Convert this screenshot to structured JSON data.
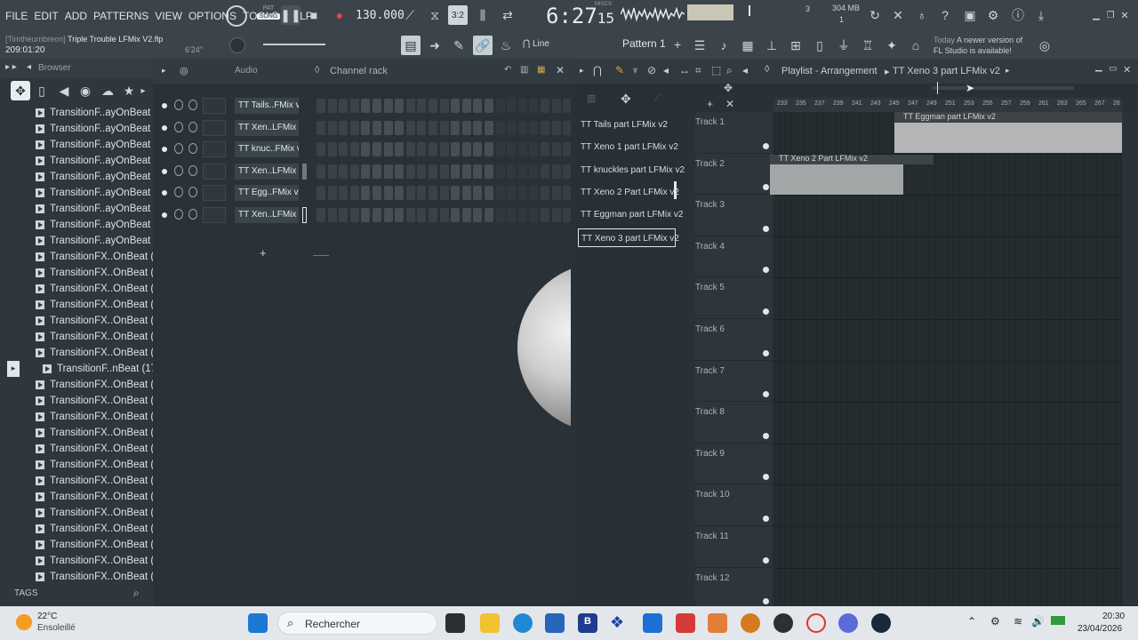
{
  "menu": [
    "FILE",
    "EDIT",
    "ADD",
    "PATTERNS",
    "VIEW",
    "OPTIONS",
    "TOOLS",
    "HELP"
  ],
  "transport": {
    "pat_label": "PAT",
    "song_label": "SONG",
    "tempo": "130.000",
    "time": "6:27",
    "time_small": "15",
    "cpu": "304 MB",
    "cpu_sub": "1",
    "misc": "MISCS",
    "beat": "3",
    "beat_sub": "3:2"
  },
  "hint": {
    "title": "Today",
    "line1": "A newer version of",
    "line2": "FL Studio is available!"
  },
  "project": {
    "user": "[Timtheumbreon]",
    "file": "Triple Trouble LFMix V2.flp",
    "time": "209:01:20",
    "pos": "6'24\""
  },
  "toolbar": {
    "snap": "Line",
    "pattern": "Pattern 1"
  },
  "browser": {
    "title": "Browser",
    "items": [
      "TransitionF..ayOnBeat (1)",
      "TransitionF..ayOnBeat (2)",
      "TransitionF..ayOnBeat (3)",
      "TransitionF..ayOnBeat (4)",
      "TransitionF..ayOnBeat (5)",
      "TransitionF..ayOnBeat (6)",
      "TransitionF..ayOnBeat (7)",
      "TransitionF..ayOnBeat (8)",
      "TransitionF..ayOnBeat (9)",
      "TransitionFX..OnBeat (10)",
      "TransitionFX..OnBeat (11)",
      "TransitionFX..OnBeat (12)",
      "TransitionFX..OnBeat (13)",
      "TransitionFX..OnBeat (14)",
      "TransitionFX..OnBeat (15)",
      "TransitionFX..OnBeat (16)",
      "TransitionF..nBeat (17)",
      "TransitionFX..OnBeat (18)",
      "TransitionFX..OnBeat (19)",
      "TransitionFX..OnBeat (20)",
      "TransitionFX..OnBeat (21)",
      "TransitionFX..OnBeat (22)",
      "TransitionFX..OnBeat (23)",
      "TransitionFX..OnBeat (24)",
      "TransitionFX..OnBeat (25)",
      "TransitionFX..OnBeat (26)",
      "TransitionFX..OnBeat (27)",
      "TransitionFX..OnBeat (28)",
      "TransitionFX..OnBeat (29)",
      "TransitionFX..OnBeat (30)"
    ],
    "tags": "TAGS"
  },
  "rack": {
    "title": "Channel rack",
    "filter": "Audio",
    "channels": [
      "TT Tails..FMix v2",
      "TT Xen..LFMix v2",
      "TT knuc..FMix v2",
      "TT Xen..LFMix v2",
      "TT Egg..FMix v2",
      "TT Xen..LFMix v2"
    ],
    "add": "+"
  },
  "patterns": [
    "TT Tails part LFMix v2",
    "TT Xeno 1 part LFMix v2",
    "TT knuckles part LFMix v2",
    "TT Xeno 2 Part LFMix v2",
    "TT Eggman part LFMix v2",
    "TT Xeno 3 part LFMix v2"
  ],
  "playlist": {
    "title": "Playlist - Arrangement",
    "crumb": "TT Xeno 3 part LFMix v2",
    "ruler": [
      "233",
      "235",
      "237",
      "239",
      "241",
      "243",
      "245",
      "247",
      "249",
      "251",
      "253",
      "255",
      "257",
      "259",
      "261",
      "263",
      "265",
      "267",
      "26"
    ],
    "tracks": [
      "Track 1",
      "Track 2",
      "Track 3",
      "Track 4",
      "Track 5",
      "Track 6",
      "Track 7",
      "Track 8",
      "Track 9",
      "Track 10",
      "Track 11",
      "Track 12"
    ],
    "clip1": "TT Eggman part LFMix v2",
    "clip2": "TT Xeno 2 Part LFMix v2"
  },
  "taskbar": {
    "temp": "22°C",
    "weather": "Ensoleillé",
    "search": "Rechercher",
    "clock": "20:30",
    "date": "23/04/2026"
  }
}
